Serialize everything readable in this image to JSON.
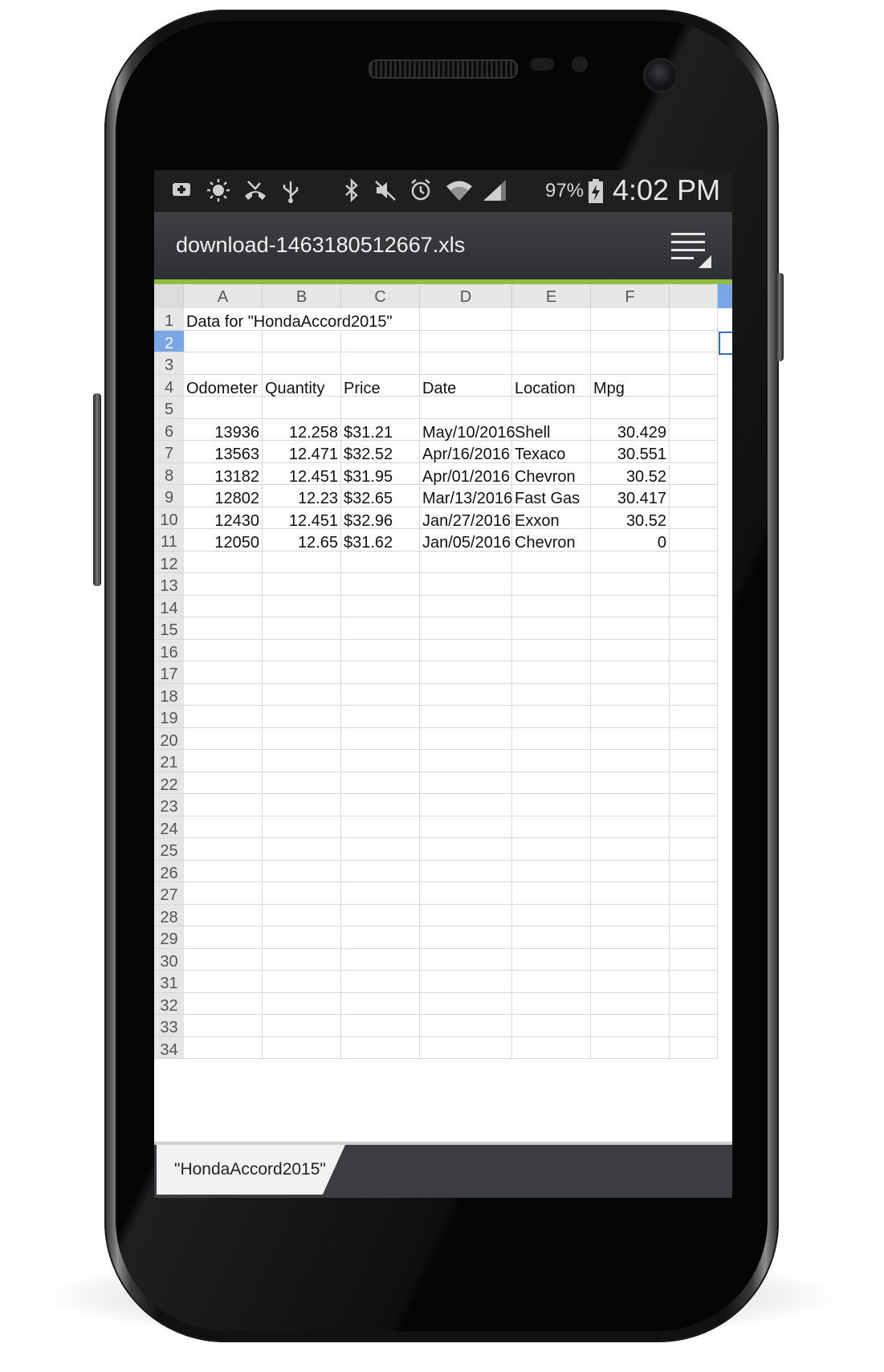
{
  "status_bar": {
    "battery_pct": "97%",
    "time": "4:02 PM",
    "icons": [
      "add-notification-icon",
      "brightness-icon",
      "missed-call-icon",
      "usb-icon",
      "bluetooth-icon",
      "mute-icon",
      "alarm-icon",
      "wifi-icon",
      "signal-icon",
      "battery-charging-icon"
    ]
  },
  "title_bar": {
    "file_name": "download-1463180512667.xls",
    "accent_color": "#8fbe3c"
  },
  "sheet": {
    "columns": [
      "A",
      "B",
      "C",
      "D",
      "E",
      "F"
    ],
    "row_numbers": [
      "1",
      "2",
      "3",
      "4",
      "5",
      "6",
      "7",
      "8",
      "9",
      "10",
      "11",
      "12",
      "13",
      "14",
      "15",
      "16",
      "17",
      "18",
      "19",
      "20",
      "21",
      "22",
      "23",
      "24",
      "25",
      "26",
      "27",
      "28",
      "29",
      "30",
      "31",
      "32",
      "33",
      "34"
    ],
    "selected_row": "2",
    "title_cell": "Data for \"HondaAccord2015\"",
    "headers": [
      "Odometer",
      "Quantity",
      "Price",
      "Date",
      "Location",
      "Mpg"
    ],
    "rows": [
      [
        "13936",
        "12.258",
        "$31.21",
        "May/10/2016",
        "Shell",
        "30.429"
      ],
      [
        "13563",
        "12.471",
        "$32.52",
        "Apr/16/2016",
        "Texaco",
        "30.551"
      ],
      [
        "13182",
        "12.451",
        "$31.95",
        "Apr/01/2016",
        "Chevron",
        "30.52"
      ],
      [
        "12802",
        "12.23",
        "$32.65",
        "Mar/13/2016",
        "Fast Gas",
        "30.417"
      ],
      [
        "12430",
        "12.451",
        "$32.96",
        "Jan/27/2016",
        "Exxon",
        "30.52"
      ],
      [
        "12050",
        "12.65",
        "$31.62",
        "Jan/05/2016",
        "Chevron",
        "0"
      ]
    ]
  },
  "sheet_tabs": [
    {
      "label": "\"HondaAccord2015\""
    }
  ]
}
